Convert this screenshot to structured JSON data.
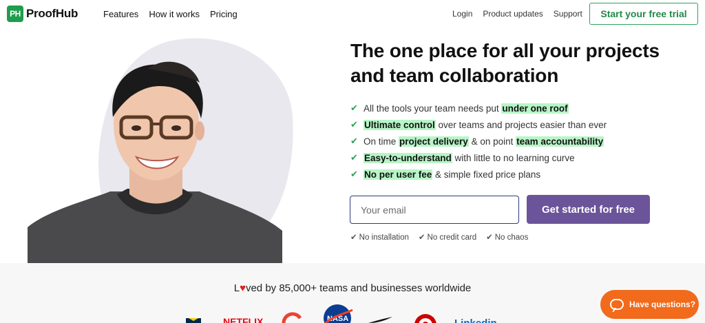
{
  "header": {
    "logo_badge": "PH",
    "logo_text": "ProofHub",
    "nav_left": [
      "Features",
      "How it works",
      "Pricing"
    ],
    "nav_right": [
      "Login",
      "Product updates",
      "Support"
    ],
    "cta": "Start your free trial"
  },
  "hero": {
    "headline": "The one place for all your projects and team collaboration",
    "features": [
      {
        "parts": [
          {
            "t": "All the tools your team needs put ",
            "hl": false
          },
          {
            "t": "under one roof",
            "hl": true
          }
        ]
      },
      {
        "parts": [
          {
            "t": "Ultimate control",
            "hl": true
          },
          {
            "t": " over teams and projects easier than ever",
            "hl": false
          }
        ]
      },
      {
        "parts": [
          {
            "t": "On time ",
            "hl": false
          },
          {
            "t": "project delivery",
            "hl": true
          },
          {
            "t": " & on point ",
            "hl": false
          },
          {
            "t": "team accountability",
            "hl": true
          }
        ]
      },
      {
        "parts": [
          {
            "t": "Easy-to-understand",
            "hl": true
          },
          {
            "t": " with little to no learning curve",
            "hl": false
          }
        ]
      },
      {
        "parts": [
          {
            "t": "No per user fee",
            "hl": true
          },
          {
            "t": " & simple fixed price plans",
            "hl": false
          }
        ]
      }
    ],
    "email_placeholder": "Your email",
    "email_value": "",
    "submit_label": "Get started for free",
    "perks": [
      "No installation",
      "No credit card",
      "No chaos"
    ]
  },
  "social_proof": {
    "loved_prefix": "L",
    "loved_suffix": "ved by 85,000+ teams and businesses worldwide",
    "logos": [
      "michigan-logo",
      "netflix-logo",
      "google-logo",
      "nasa-logo",
      "nike-logo",
      "target-logo",
      "linkedin-logo"
    ]
  },
  "help_widget": {
    "label": "Have questions?"
  },
  "colors": {
    "brand_green": "#1f9c4c",
    "highlight": "#b7f5c6",
    "purple_button": "#6b5499",
    "orange_help": "#f26a1b"
  }
}
